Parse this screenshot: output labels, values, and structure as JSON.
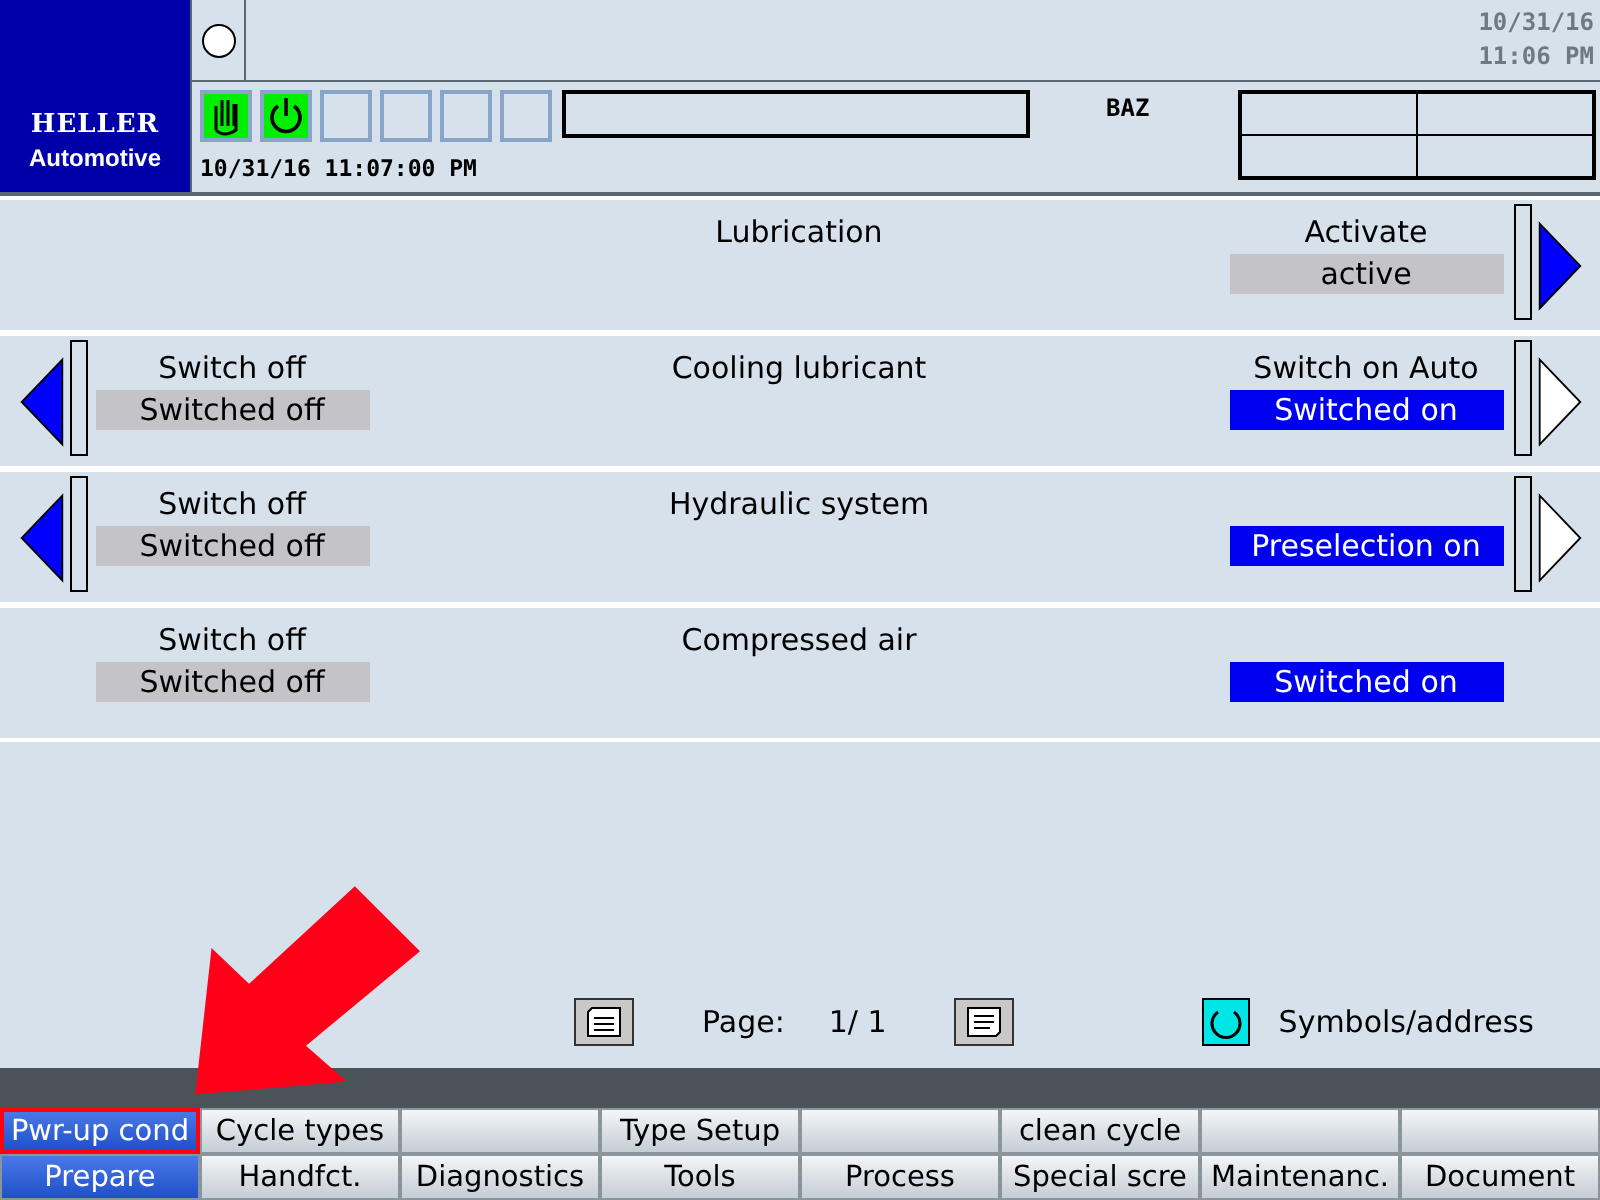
{
  "header": {
    "logo": {
      "brand": "HELLER",
      "sub": "Automotive"
    },
    "clock": {
      "date": "10/31/16",
      "time": "11:06 PM"
    },
    "timestamp": "10/31/16 11:07:00 PM",
    "mode": "BAZ"
  },
  "rows": [
    {
      "title": "Lubrication",
      "left_arrow": false,
      "right_arrow": true,
      "right_arrow_filled": true,
      "right": {
        "label": "Activate",
        "value": "active",
        "highlighted": false
      }
    },
    {
      "title": "Cooling lubricant",
      "left_arrow": true,
      "right_arrow": true,
      "right_arrow_filled": false,
      "left": {
        "label": "Switch off",
        "value": "Switched off",
        "highlighted": false
      },
      "right": {
        "label": "Switch on Auto",
        "value": "Switched on",
        "highlighted": true
      }
    },
    {
      "title": "Hydraulic system",
      "left_arrow": true,
      "right_arrow": true,
      "right_arrow_filled": false,
      "left": {
        "label": "Switch off",
        "value": "Switched off",
        "highlighted": false
      },
      "right": {
        "value": "Preselection on",
        "highlighted": true
      }
    },
    {
      "title": "Compressed air",
      "left_arrow": false,
      "right_arrow": false,
      "left": {
        "label": "Switch off",
        "value": "Switched off",
        "highlighted": false
      },
      "right": {
        "value": "Switched on",
        "highlighted": true
      }
    }
  ],
  "pager": {
    "label": "Page:",
    "value": "1/ 1",
    "symbols": "Symbols/address"
  },
  "softkeys_top": [
    {
      "label": "Pwr-up cond",
      "selected": true
    },
    {
      "label": "Cycle types",
      "selected": false
    },
    {
      "selected": false
    },
    {
      "label": "Type Setup",
      "selected": false
    },
    {
      "selected": false
    },
    {
      "label": "clean cycle",
      "selected": false
    },
    {
      "selected": false
    },
    {
      "selected": false
    }
  ],
  "softkeys_bottom": [
    {
      "label": "Prepare",
      "selected": true
    },
    {
      "label": "Handfct.",
      "selected": false
    },
    {
      "label": "Diagnostics",
      "selected": false
    },
    {
      "label": "Tools",
      "selected": false
    },
    {
      "label": "Process",
      "selected": false
    },
    {
      "label": "Special scre",
      "selected": false
    },
    {
      "label": "Maintenanc.",
      "selected": false
    },
    {
      "label": "Document",
      "selected": false
    }
  ]
}
